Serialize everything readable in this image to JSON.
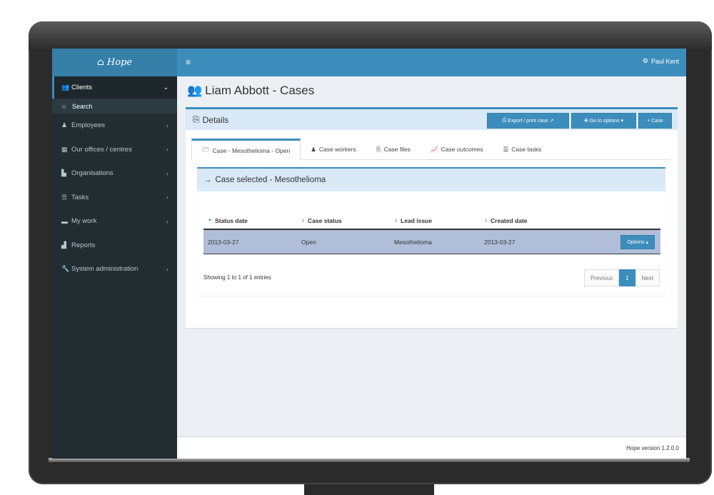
{
  "brand": {
    "icon": "home-icon",
    "name": "Hope"
  },
  "header": {
    "menu_icon": "hamburger-icon",
    "user_icon": "cogs-icon",
    "user_name": "Paul Kent"
  },
  "sidebar": {
    "items": [
      {
        "label": "Clients",
        "icon": "users-icon",
        "expanded": true
      },
      {
        "label": "Employees",
        "icon": "user-icon"
      },
      {
        "label": "Our offices / centres",
        "icon": "building-icon"
      },
      {
        "label": "Organisations",
        "icon": "industry-icon"
      },
      {
        "label": "Tasks",
        "icon": "list-icon"
      },
      {
        "label": "My work",
        "icon": "briefcase-icon"
      },
      {
        "label": "Reports",
        "icon": "bar-chart-icon"
      },
      {
        "label": "System administration",
        "icon": "wrench-icon"
      }
    ],
    "subitem": {
      "label": "Search",
      "icon": "circle-icon"
    }
  },
  "page": {
    "title": "Liam Abbott - Cases",
    "title_icon": "users-icon"
  },
  "details": {
    "title": "Details",
    "buttons": {
      "export": "Export / print case",
      "goto": "Go to options",
      "add_case": "Case"
    }
  },
  "tabs": [
    {
      "label": "Case - Mesothelioma - Open",
      "icon": "folder-open-icon"
    },
    {
      "label": "Case workers",
      "icon": "user-icon"
    },
    {
      "label": "Case files",
      "icon": "copy-icon"
    },
    {
      "label": "Case outcomes",
      "icon": "line-chart-icon"
    },
    {
      "label": "Case tasks",
      "icon": "list-icon"
    }
  ],
  "case_selected": {
    "title": "Case selected - Mesothelioma",
    "icon": "arrow-right-icon"
  },
  "table": {
    "columns": [
      "Status date",
      "Case status",
      "Lead issue",
      "Created date"
    ],
    "rows": [
      {
        "status_date": "2013-03-27",
        "case_status": "Open",
        "lead_issue": "Mesothelioma",
        "created_date": "2013-03-27",
        "action": "Options"
      }
    ],
    "showing": "Showing 1 to 1 of 1 entries",
    "pagination": {
      "previous": "Previous",
      "current": "1",
      "next": "Next"
    }
  },
  "footer": {
    "version": "Hope version 1.2.0.0"
  },
  "colors": {
    "accent": "#3c8dbc",
    "sidebar_bg": "#222d32",
    "row_selected": "#b0bed9"
  }
}
